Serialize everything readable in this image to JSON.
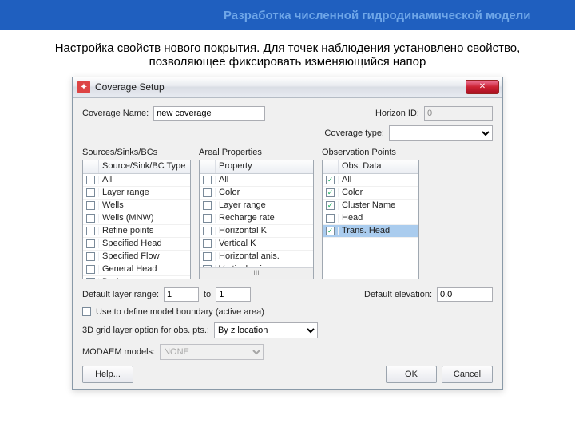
{
  "page": {
    "header": "Разработка численной гидродинамической модели",
    "description": "Настройка свойств нового покрытия. Для точек наблюдения установлено свойство, позволяющее фиксировать изменяющийся напор"
  },
  "dialog": {
    "title": "Coverage Setup",
    "close": "✕",
    "coverage_name_label": "Coverage Name:",
    "coverage_name_value": "new coverage",
    "horizon_label": "Horizon ID:",
    "horizon_value": "0",
    "coverage_type_label": "Coverage type:",
    "coverage_type_value": "",
    "group1": {
      "label": "Sources/Sinks/BCs",
      "header": "Source/Sink/BC Type",
      "items": [
        {
          "label": "All",
          "checked": false
        },
        {
          "label": "Layer range",
          "checked": false
        },
        {
          "label": "Wells",
          "checked": false
        },
        {
          "label": "Wells (MNW)",
          "checked": false
        },
        {
          "label": "Refine points",
          "checked": false
        },
        {
          "label": "Specified Head",
          "checked": false
        },
        {
          "label": "Specified Flow",
          "checked": false
        },
        {
          "label": "General Head",
          "checked": false
        },
        {
          "label": "Drain",
          "checked": false
        }
      ]
    },
    "group2": {
      "label": "Areal Properties",
      "header": "Property",
      "items": [
        {
          "label": "All",
          "checked": false
        },
        {
          "label": "Color",
          "checked": false
        },
        {
          "label": "Layer range",
          "checked": false
        },
        {
          "label": "Recharge rate",
          "checked": false
        },
        {
          "label": "Horizontal K",
          "checked": false
        },
        {
          "label": "Vertical K",
          "checked": false
        },
        {
          "label": "Horizontal anis.",
          "checked": false
        },
        {
          "label": "Vertical anis.",
          "checked": false
        }
      ],
      "scroll_thumb": "III"
    },
    "group3": {
      "label": "Observation Points",
      "header": "Obs. Data",
      "items": [
        {
          "label": "All",
          "checked": true
        },
        {
          "label": "Color",
          "checked": true
        },
        {
          "label": "Cluster Name",
          "checked": true
        },
        {
          "label": "Head",
          "checked": false
        },
        {
          "label": "Trans. Head",
          "checked": true,
          "selected": true
        }
      ]
    },
    "default_layer_label": "Default layer range:",
    "default_layer_from": "1",
    "default_layer_to_label": "to",
    "default_layer_to": "1",
    "default_elev_label": "Default elevation:",
    "default_elev_value": "0.0",
    "boundary_checkbox_label": "Use to define model boundary (active area)",
    "obs_option_label": "3D grid layer option for obs. pts.:",
    "obs_option_value": "By z location",
    "modaem_label": "MODAEM models:",
    "modaem_value": "NONE",
    "help_btn": "Help...",
    "ok_btn": "OK",
    "cancel_btn": "Cancel"
  }
}
